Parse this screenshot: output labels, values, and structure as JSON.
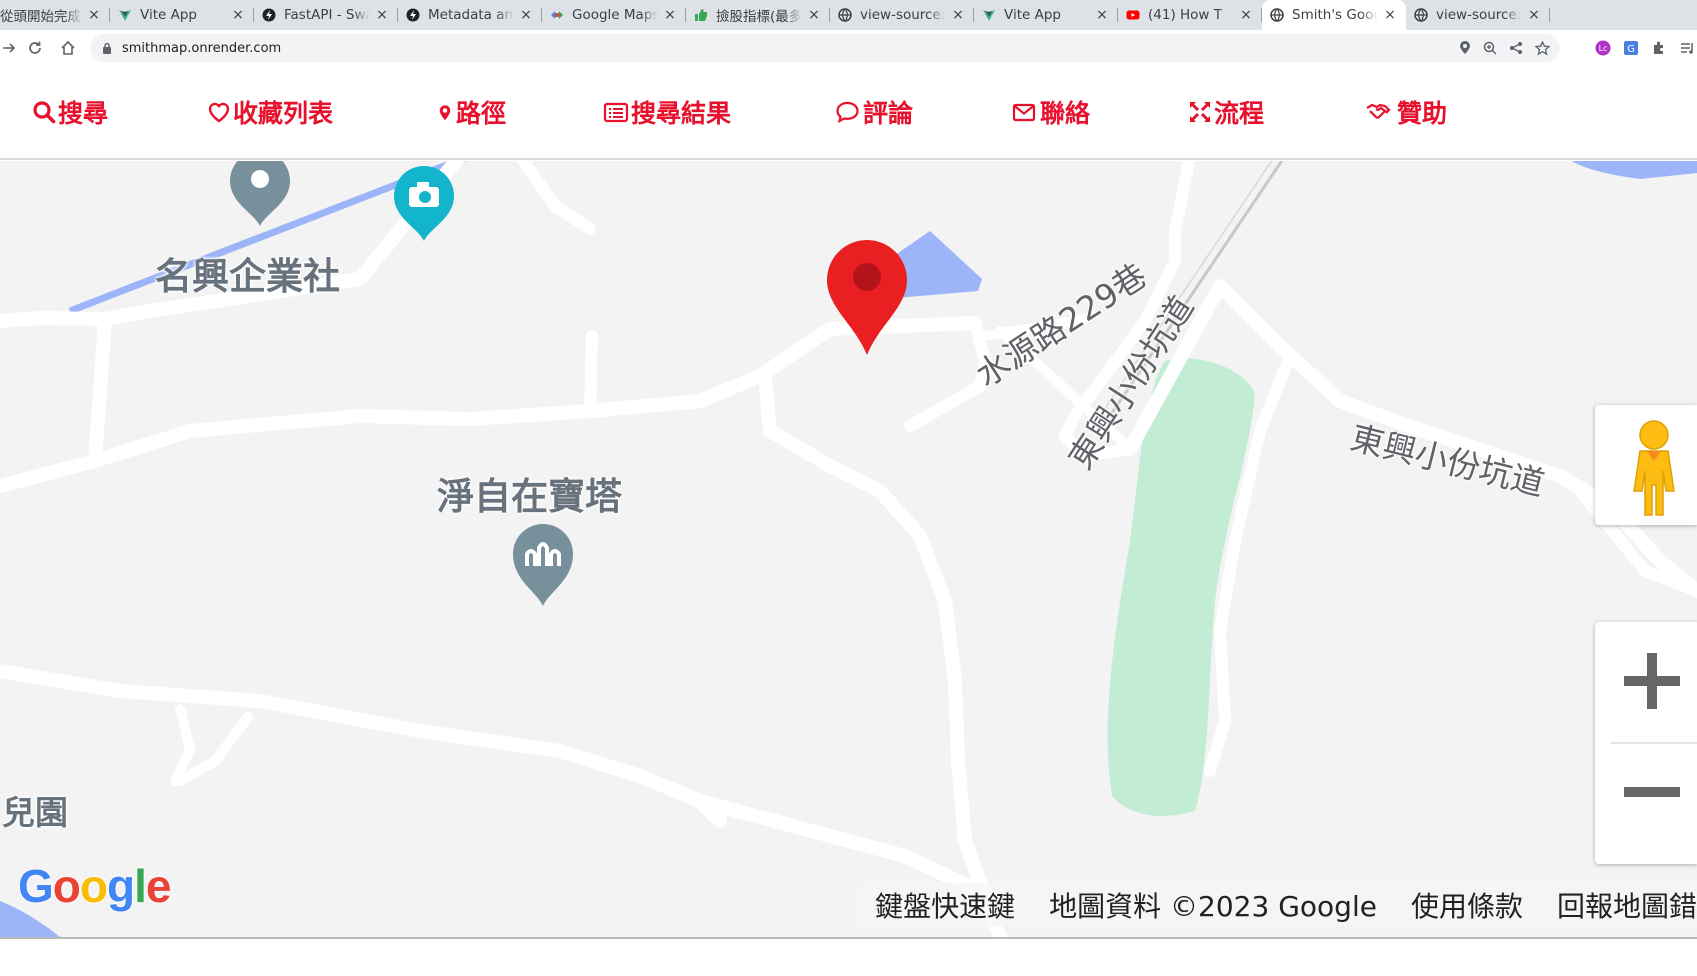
{
  "browser": {
    "tabs": [
      {
        "title": "從頭開始完成",
        "icon": "page-icon",
        "active": false
      },
      {
        "title": "Vite App",
        "icon": "vite-icon",
        "active": false
      },
      {
        "title": "FastAPI - Swa",
        "icon": "fastapi-icon",
        "active": false
      },
      {
        "title": "Metadata and",
        "icon": "fastapi-icon",
        "active": false
      },
      {
        "title": "Google Maps",
        "icon": "google-maps-icon",
        "active": false
      },
      {
        "title": "撿股指標(最多",
        "icon": "thumbs-up-icon",
        "active": false
      },
      {
        "title": "view-source:",
        "icon": "globe-icon",
        "active": false
      },
      {
        "title": "Vite App",
        "icon": "vite-icon",
        "active": false
      },
      {
        "title": "(41) How T",
        "icon": "youtube-icon",
        "active": false
      },
      {
        "title": "Smith's Goog",
        "icon": "globe-icon",
        "active": true
      },
      {
        "title": "view-source:",
        "icon": "globe-icon",
        "active": false
      }
    ],
    "close_glyph": "×",
    "url": "smithmap.onrender.com"
  },
  "site_nav": {
    "items": [
      {
        "label": "搜尋",
        "icon": "search-icon"
      },
      {
        "label": "收藏列表",
        "icon": "heart-icon"
      },
      {
        "label": "路徑",
        "icon": "map-pin-icon"
      },
      {
        "label": "搜尋結果",
        "icon": "list-icon"
      },
      {
        "label": "評論",
        "icon": "comment-icon"
      },
      {
        "label": "聯絡",
        "icon": "envelope-icon"
      },
      {
        "label": "流程",
        "icon": "arrows-expand-icon"
      },
      {
        "label": "贊助",
        "icon": "handshake-icon"
      }
    ],
    "accent": "#e8112d"
  },
  "map": {
    "labels": {
      "poi_company": "名興企業社",
      "poi_pagoda": "淨自在寶塔",
      "road_shuiyuan": "水源路229巷",
      "road_dongxing_1": "東興小份坑道",
      "road_dongxing_2": "東興小份坑道",
      "corner_left": "兒園",
      "corner_right": "東"
    },
    "logo": "Google",
    "attribution": {
      "shortcuts": "鍵盤快速鍵",
      "data": "地圖資料 ©2023 Google",
      "terms": "使用條款",
      "report": "回報地圖錯"
    },
    "colors": {
      "background": "#f3f3f3",
      "road": "#ffffff",
      "water": "#9cb5f8",
      "park": "#c3ecd4",
      "marker": "#ea1f22"
    }
  }
}
